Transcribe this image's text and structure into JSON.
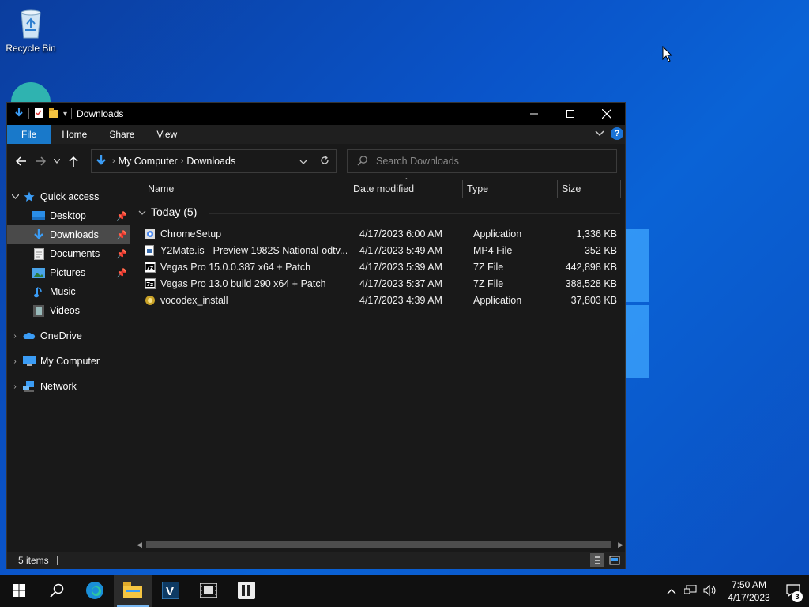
{
  "desktop": {
    "icons": [
      {
        "label": "Recycle Bin",
        "icon": "recycle-bin-icon"
      }
    ]
  },
  "window": {
    "title": "Downloads",
    "ribbon_tabs": [
      "File",
      "Home",
      "Share",
      "View"
    ],
    "address": {
      "crumbs": [
        "My Computer",
        "Downloads"
      ]
    },
    "search": {
      "placeholder": "Search Downloads"
    },
    "nav": {
      "quick_access": "Quick access",
      "items": [
        {
          "label": "Desktop",
          "icon": "desktop-icon",
          "pinned": true
        },
        {
          "label": "Downloads",
          "icon": "downloads-icon",
          "pinned": true,
          "selected": true
        },
        {
          "label": "Documents",
          "icon": "documents-icon",
          "pinned": true
        },
        {
          "label": "Pictures",
          "icon": "pictures-icon",
          "pinned": true
        },
        {
          "label": "Music",
          "icon": "music-icon",
          "pinned": false
        },
        {
          "label": "Videos",
          "icon": "videos-icon",
          "pinned": false
        }
      ],
      "roots": [
        {
          "label": "OneDrive",
          "icon": "onedrive-icon"
        },
        {
          "label": "My Computer",
          "icon": "computer-icon"
        },
        {
          "label": "Network",
          "icon": "network-icon"
        }
      ]
    },
    "columns": {
      "name": "Name",
      "date": "Date modified",
      "type": "Type",
      "size": "Size"
    },
    "group": "Today (5)",
    "files": [
      {
        "name": "ChromeSetup",
        "date": "4/17/2023 6:00 AM",
        "type": "Application",
        "size": "1,336 KB",
        "icon": "installer-icon"
      },
      {
        "name": "Y2Mate.is - Preview 1982S National-odtv...",
        "date": "4/17/2023 5:49 AM",
        "type": "MP4 File",
        "size": "352 KB",
        "icon": "video-file-icon"
      },
      {
        "name": "Vegas Pro 15.0.0.387 x64 + Patch",
        "date": "4/17/2023 5:39 AM",
        "type": "7Z File",
        "size": "442,898 KB",
        "icon": "7z-archive-icon"
      },
      {
        "name": "Vegas Pro 13.0 build 290 x64 + Patch",
        "date": "4/17/2023 5:37 AM",
        "type": "7Z File",
        "size": "388,528 KB",
        "icon": "7z-archive-icon"
      },
      {
        "name": "vocodex_install",
        "date": "4/17/2023 4:39 AM",
        "type": "Application",
        "size": "37,803 KB",
        "icon": "app-installer-icon"
      }
    ],
    "status": {
      "count": "5 items"
    }
  },
  "taskbar": {
    "time": "7:50 AM",
    "date": "4/17/2023",
    "notifications": "3"
  }
}
